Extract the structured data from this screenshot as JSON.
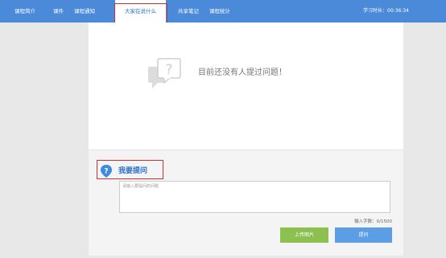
{
  "nav": {
    "tabs": [
      {
        "label": "课程简介"
      },
      {
        "label": "课件"
      },
      {
        "label": "课程通知"
      },
      {
        "label": "大家在说什么"
      },
      {
        "label": "共享笔记"
      },
      {
        "label": "课程统计"
      }
    ],
    "active_tab": "大家在说什么",
    "study_time_label": "学习时长：",
    "study_time_value": "00:36:34"
  },
  "empty_state": {
    "message": "目前还没有人提过问题！",
    "icon": "question-bubble-icon"
  },
  "ask": {
    "title": "我要提问",
    "icon": "question-pin-icon",
    "placeholder": "请输入要提问的问题",
    "value": "",
    "char_count_label": "输入字数：",
    "char_count": "0/1500",
    "upload_button": "上传图片",
    "submit_button": "提问"
  },
  "colors": {
    "nav_background": "#4a8ad8",
    "highlight_border": "#d0302f",
    "upload_button": "#8cc152",
    "submit_button": "#5c9ee6",
    "accent_text": "#2a6fd0"
  }
}
